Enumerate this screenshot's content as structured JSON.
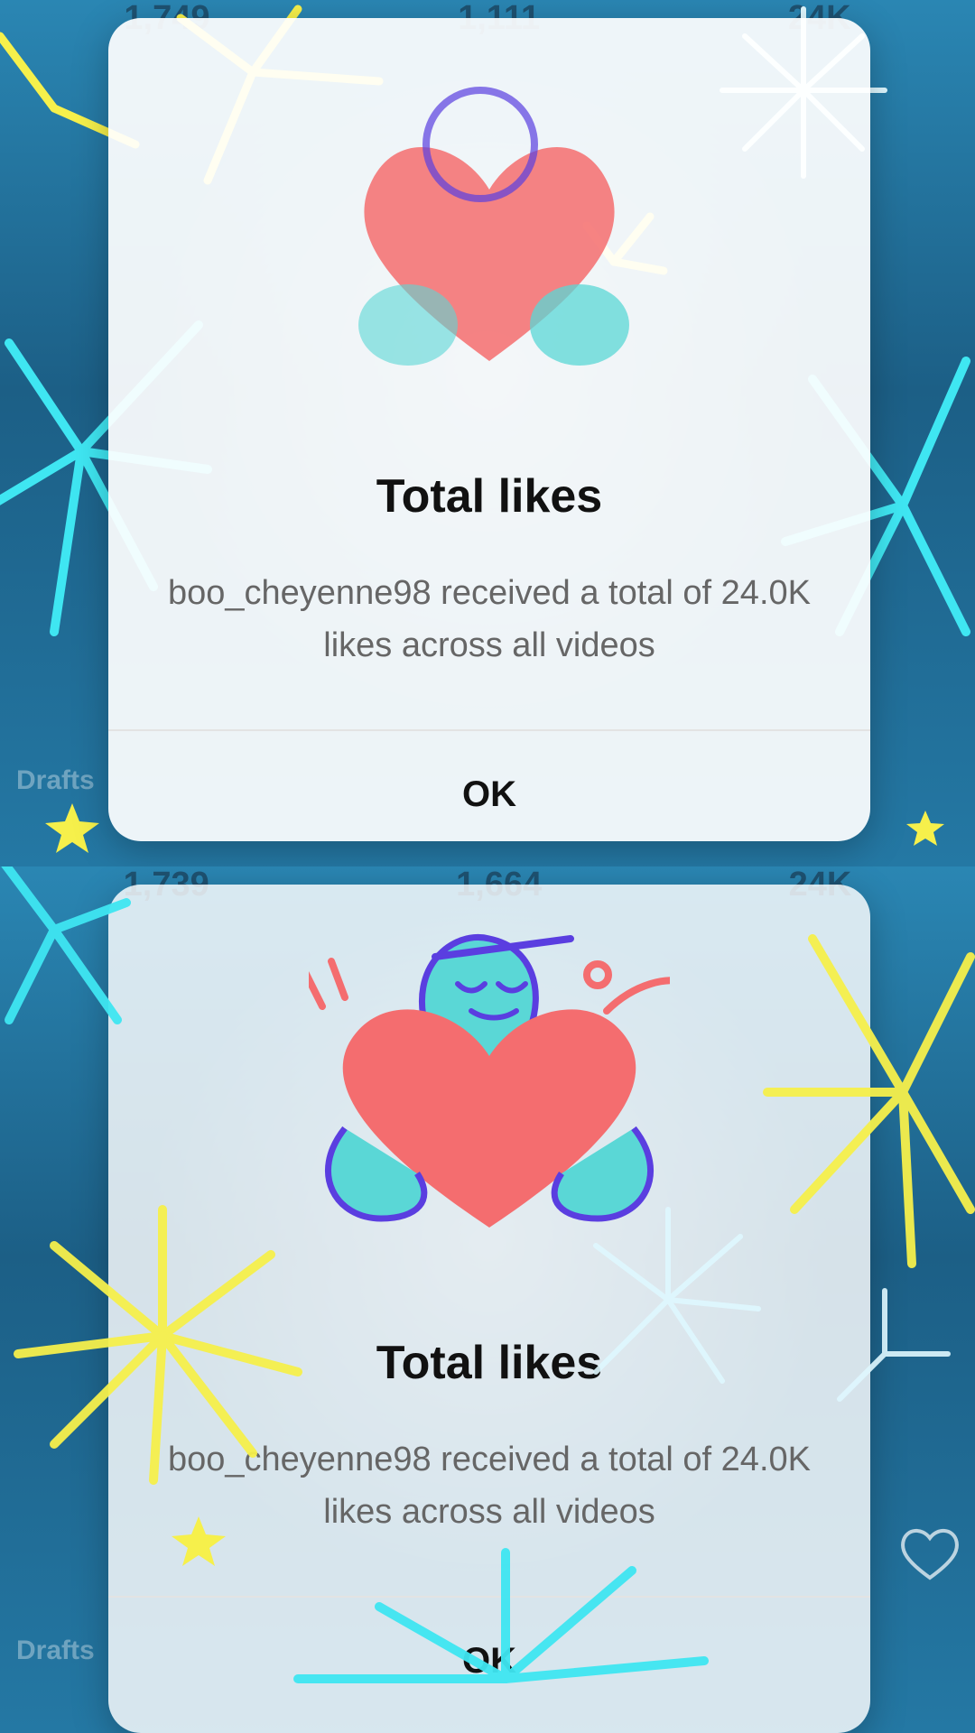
{
  "panels": [
    {
      "title": "Total likes",
      "description": "boo_cheyenne98 received a total of 24.0K likes across all videos",
      "ok_label": "OK",
      "drafts_label": "Drafts",
      "stats": [
        "1,749",
        "1,111",
        "24K"
      ]
    },
    {
      "title": "Total likes",
      "description": "boo_cheyenne98 received a total of 24.0K likes across all videos",
      "ok_label": "OK",
      "drafts_label": "Drafts",
      "stats": [
        "1,739",
        "1,664",
        "24K"
      ]
    }
  ],
  "colors": {
    "firework_yellow": "#f6f04b",
    "firework_cyan": "#3fe6f2",
    "heart": "#f46d6f",
    "figure": "#5ad7d6",
    "outline": "#5a3ee0"
  }
}
